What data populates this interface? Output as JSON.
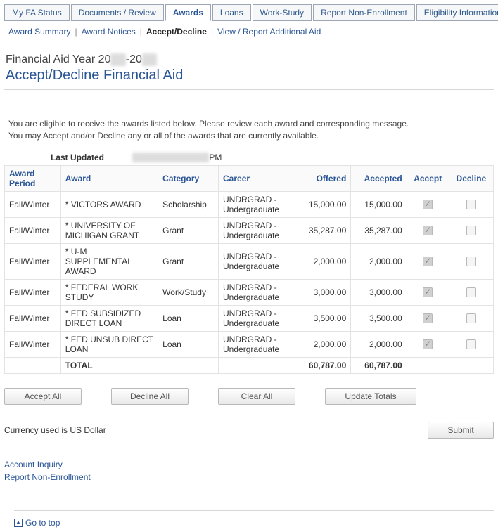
{
  "tabs": [
    "My FA Status",
    "Documents / Review",
    "Awards",
    "Loans",
    "Work-Study",
    "Report Non-Enrollment",
    "Eligibility Information"
  ],
  "active_tab_index": 2,
  "subnav": {
    "items": [
      "Award Summary",
      "Award Notices",
      "Accept/Decline",
      "View / Report Additional Aid"
    ],
    "current_index": 2
  },
  "year_line_prefix": "Financial Aid Year 20",
  "year_line_mid": "-20",
  "page_title": "Accept/Decline Financial Aid",
  "intro_line1": "You are eligible to receive the awards listed below. Please review each award and corresponding message.",
  "intro_line2": "You may Accept and/or Decline any or all of the awards that are currently available.",
  "last_updated_label": "Last Updated",
  "last_updated_suffix": "PM",
  "columns": {
    "period": "Award Period",
    "award": "Award",
    "category": "Category",
    "career": "Career",
    "offered": "Offered",
    "accepted": "Accepted",
    "accept": "Accept",
    "decline": "Decline"
  },
  "rows": [
    {
      "period": "Fall/Winter",
      "award": "* VICTORS AWARD",
      "category": "Scholarship",
      "career": "UNDRGRAD - Undergraduate",
      "offered": "15,000.00",
      "accepted": "15,000.00",
      "accept": true,
      "decline": false
    },
    {
      "period": "Fall/Winter",
      "award": "* UNIVERSITY OF MICHIGAN GRANT",
      "category": "Grant",
      "career": "UNDRGRAD - Undergraduate",
      "offered": "35,287.00",
      "accepted": "35,287.00",
      "accept": true,
      "decline": false
    },
    {
      "period": "Fall/Winter",
      "award": "* U-M SUPPLEMENTAL AWARD",
      "category": "Grant",
      "career": "UNDRGRAD - Undergraduate",
      "offered": "2,000.00",
      "accepted": "2,000.00",
      "accept": true,
      "decline": false
    },
    {
      "period": "Fall/Winter",
      "award": "* FEDERAL WORK STUDY",
      "category": "Work/Study",
      "career": "UNDRGRAD - Undergraduate",
      "offered": "3,000.00",
      "accepted": "3,000.00",
      "accept": true,
      "decline": false
    },
    {
      "period": "Fall/Winter",
      "award": "* FED SUBSIDIZED DIRECT LOAN",
      "category": "Loan",
      "career": "UNDRGRAD - Undergraduate",
      "offered": "3,500.00",
      "accepted": "3,500.00",
      "accept": true,
      "decline": false
    },
    {
      "period": "Fall/Winter",
      "award": "* FED UNSUB DIRECT LOAN",
      "category": "Loan",
      "career": "UNDRGRAD - Undergraduate",
      "offered": "2,000.00",
      "accepted": "2,000.00",
      "accept": true,
      "decline": false
    }
  ],
  "total_label": "TOTAL",
  "total_offered": "60,787.00",
  "total_accepted": "60,787.00",
  "buttons": {
    "accept_all": "Accept All",
    "decline_all": "Decline All",
    "clear_all": "Clear All",
    "update_totals": "Update Totals",
    "submit": "Submit"
  },
  "currency_text": "Currency used is US Dollar",
  "bottom_links": {
    "account_inquiry": "Account Inquiry",
    "report_non_enrollment": "Report Non-Enrollment"
  },
  "go_top": "Go to top"
}
